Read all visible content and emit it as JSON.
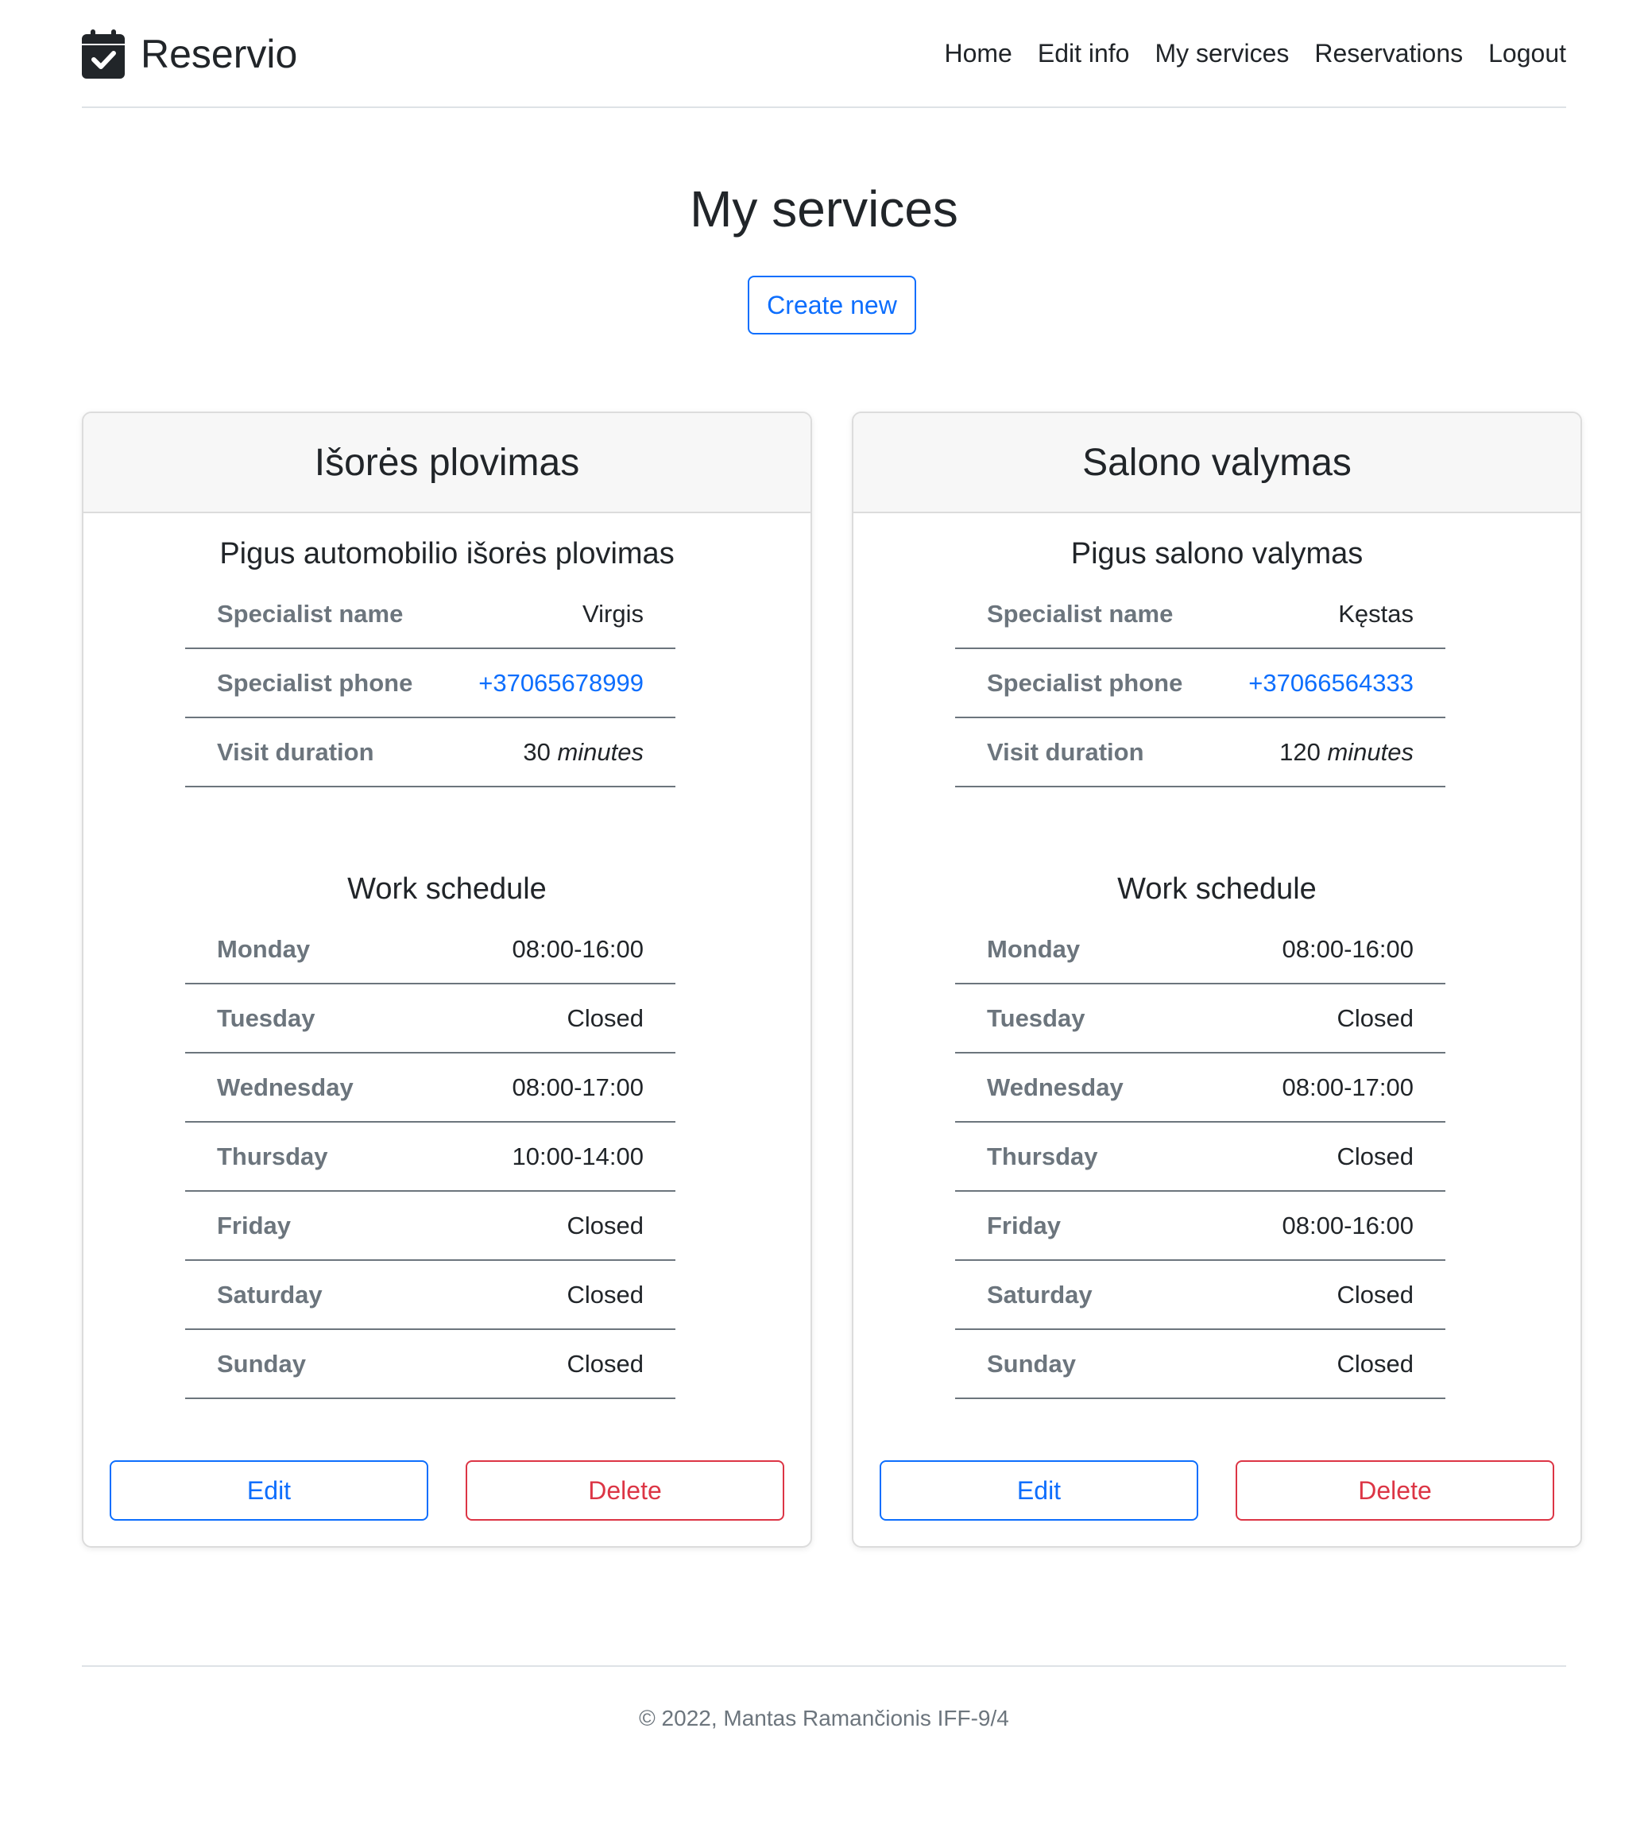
{
  "brand": {
    "name": "Reservio",
    "icon": "calendar-check-icon"
  },
  "nav": {
    "items": [
      {
        "label": "Home"
      },
      {
        "label": "Edit info"
      },
      {
        "label": "My services"
      },
      {
        "label": "Reservations"
      },
      {
        "label": "Logout"
      }
    ]
  },
  "page": {
    "title": "My services",
    "create_label": "Create new"
  },
  "services": [
    {
      "title": "Išorės plovimas",
      "description": "Pigus automobilio išorės plovimas",
      "info": [
        {
          "label": "Specialist name",
          "value": "Virgis"
        },
        {
          "label": "Specialist phone",
          "value": "+37065678999"
        },
        {
          "label": "Visit duration",
          "value": "30",
          "unit": "minutes"
        }
      ],
      "schedule_title": "Work schedule",
      "schedule": [
        {
          "day": "Monday",
          "hours": "08:00-16:00"
        },
        {
          "day": "Tuesday",
          "hours": "Closed"
        },
        {
          "day": "Wednesday",
          "hours": "08:00-17:00"
        },
        {
          "day": "Thursday",
          "hours": "10:00-14:00"
        },
        {
          "day": "Friday",
          "hours": "Closed"
        },
        {
          "day": "Saturday",
          "hours": "Closed"
        },
        {
          "day": "Sunday",
          "hours": "Closed"
        }
      ],
      "edit_label": "Edit",
      "delete_label": "Delete"
    },
    {
      "title": "Salono valymas",
      "description": "Pigus salono valymas",
      "info": [
        {
          "label": "Specialist name",
          "value": "Kęstas"
        },
        {
          "label": "Specialist phone",
          "value": "+37066564333"
        },
        {
          "label": "Visit duration",
          "value": "120",
          "unit": "minutes"
        }
      ],
      "schedule_title": "Work schedule",
      "schedule": [
        {
          "day": "Monday",
          "hours": "08:00-16:00"
        },
        {
          "day": "Tuesday",
          "hours": "Closed"
        },
        {
          "day": "Wednesday",
          "hours": "08:00-17:00"
        },
        {
          "day": "Thursday",
          "hours": "Closed"
        },
        {
          "day": "Friday",
          "hours": "08:00-16:00"
        },
        {
          "day": "Saturday",
          "hours": "Closed"
        },
        {
          "day": "Sunday",
          "hours": "Closed"
        }
      ],
      "edit_label": "Edit",
      "delete_label": "Delete"
    }
  ],
  "footer": {
    "text": "© 2022, Mantas Ramančionis IFF-9/4"
  },
  "colors": {
    "primary": "#0d6efd",
    "danger": "#dc3545",
    "muted": "#6c757d",
    "text": "#212529"
  }
}
